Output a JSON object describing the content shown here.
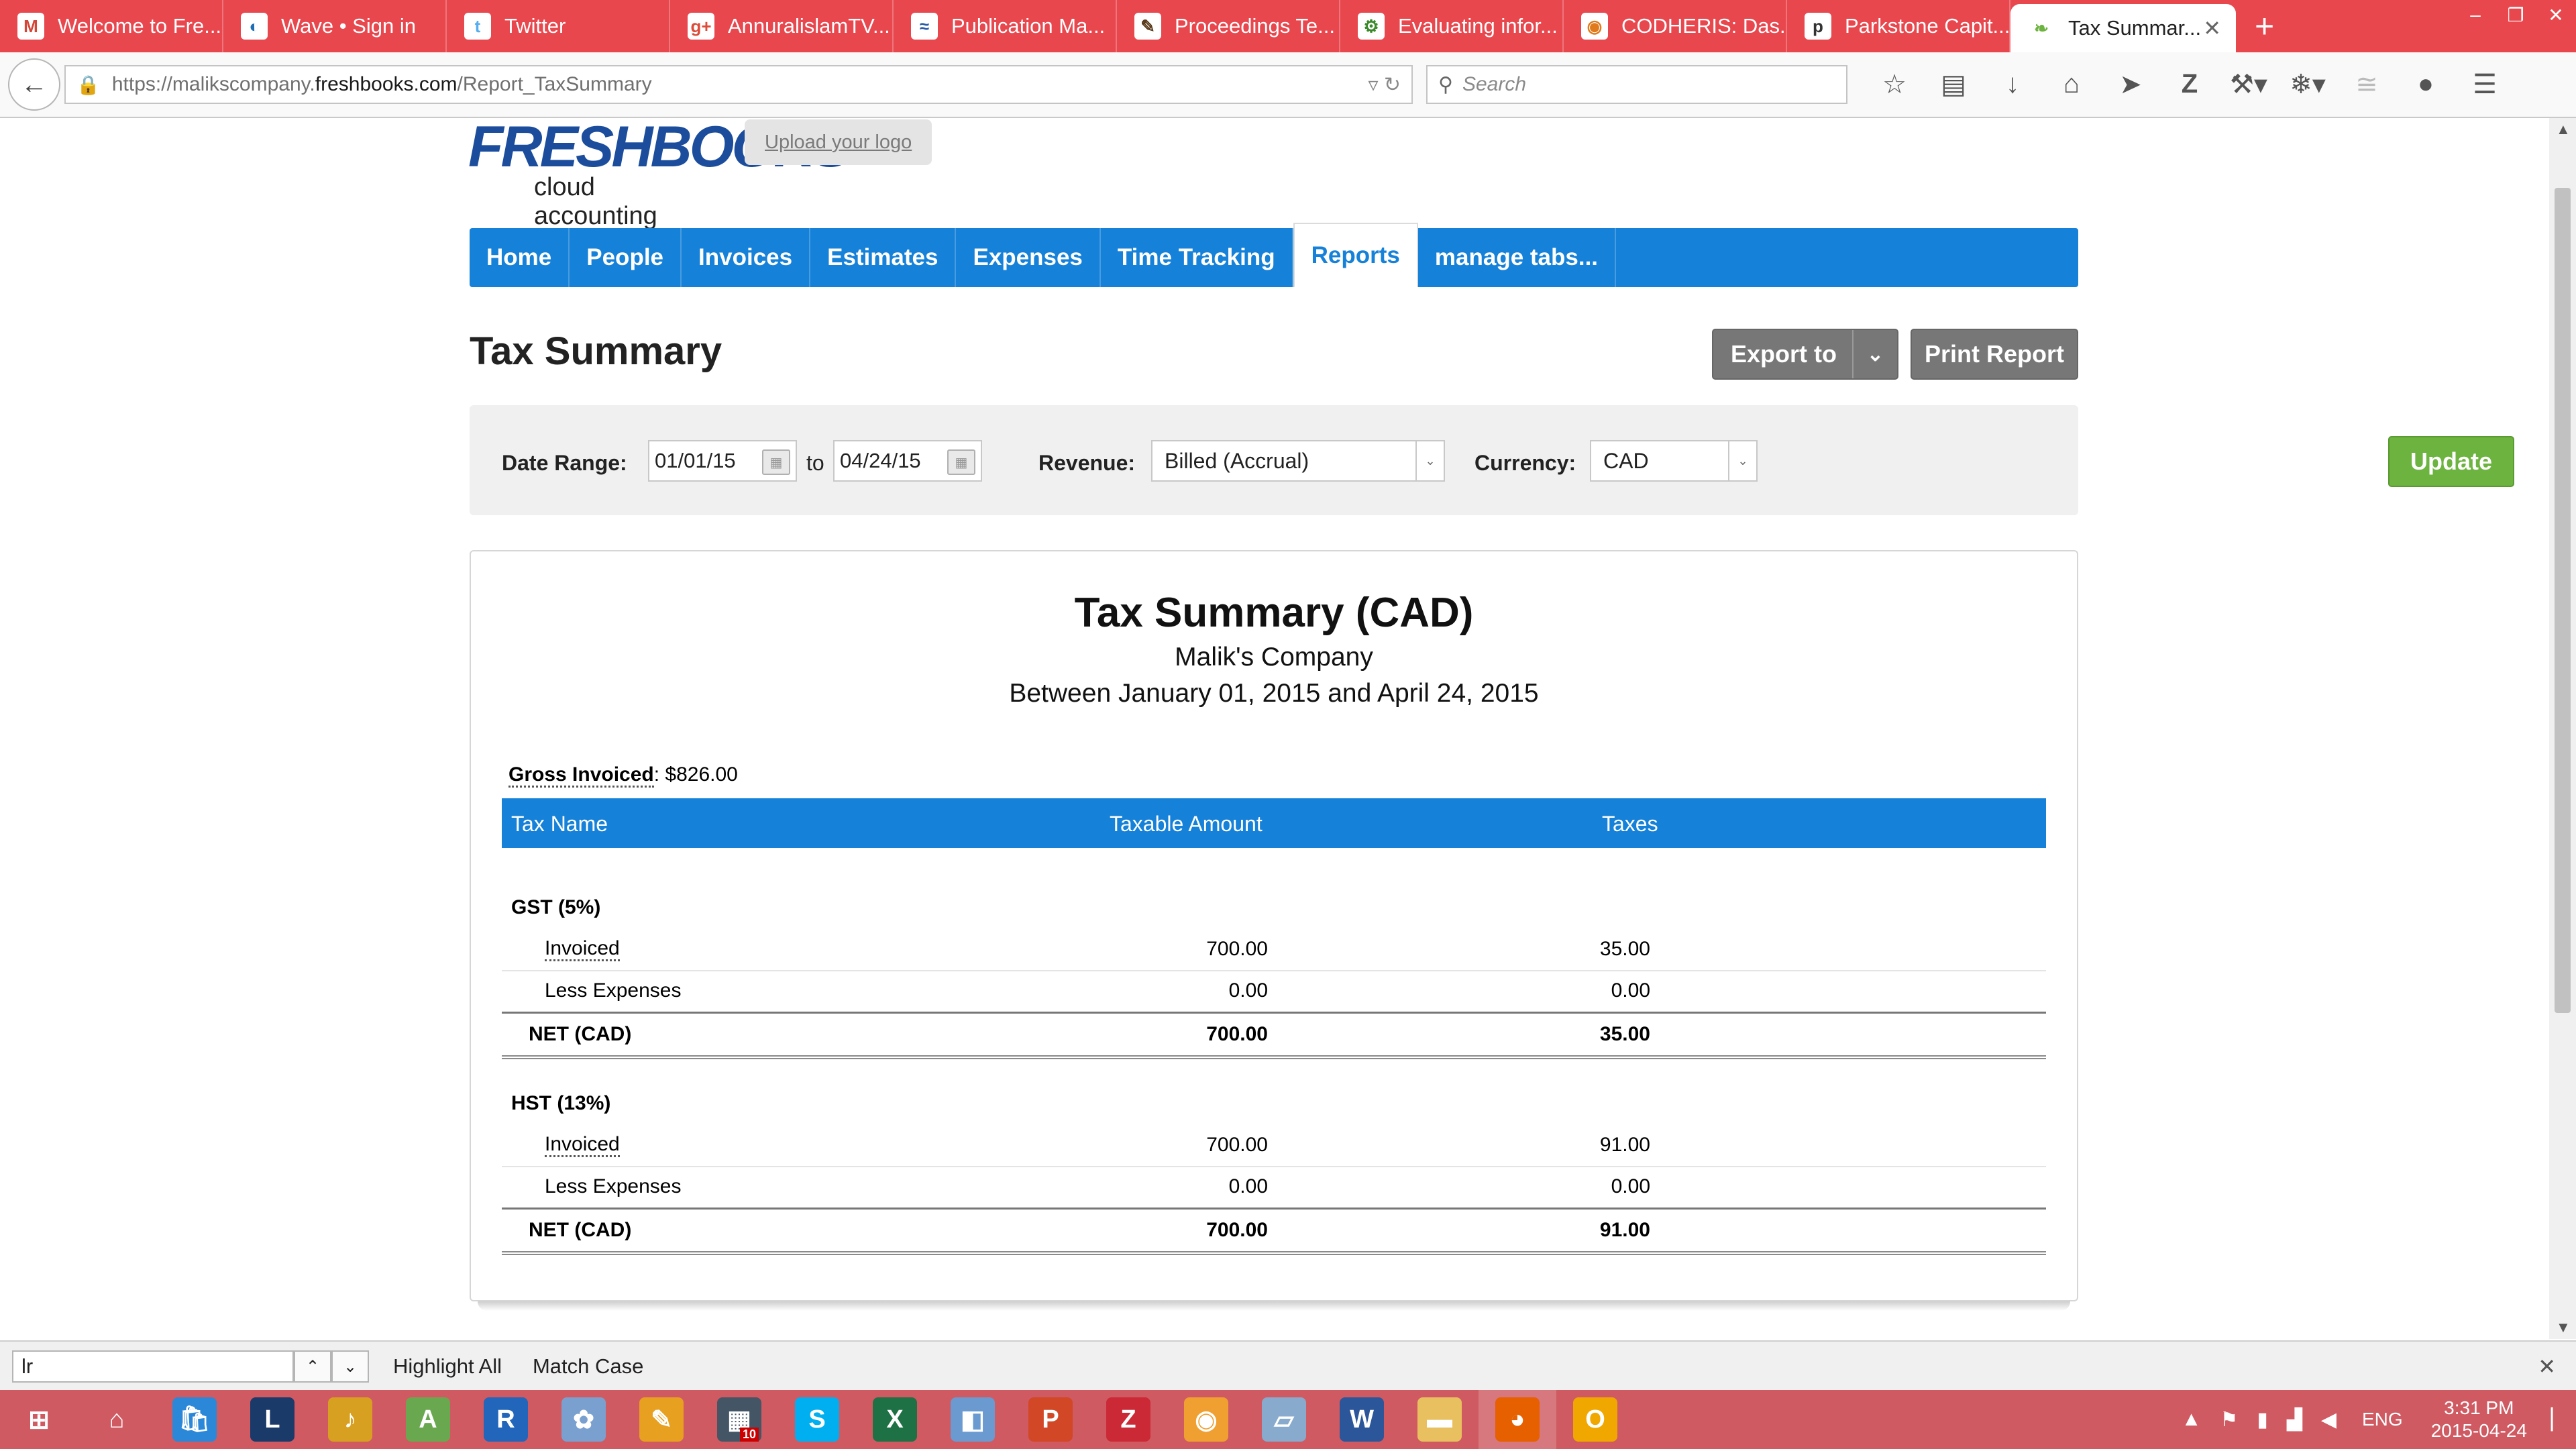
{
  "browser": {
    "tabs": [
      {
        "label": "Welcome to Fre...",
        "icon": "gmail-icon",
        "color": "#d44638",
        "glyph": "M"
      },
      {
        "label": "Wave • Sign in",
        "icon": "wave-icon",
        "color": "#1c6fb5",
        "glyph": "◐"
      },
      {
        "label": "Twitter",
        "icon": "twitter-icon",
        "color": "#55acee",
        "glyph": "t"
      },
      {
        "label": "AnnuralislamTV...",
        "icon": "google-plus-icon",
        "color": "#dd4b39",
        "glyph": "g+"
      },
      {
        "label": "Publication Ma...",
        "icon": "publication-icon",
        "color": "#2a5ca8",
        "glyph": "≈"
      },
      {
        "label": "Proceedings Te...",
        "icon": "proceedings-icon",
        "color": "#5a3a1a",
        "glyph": "✎"
      },
      {
        "label": "Evaluating infor...",
        "icon": "evaluating-icon",
        "color": "#3a8a2a",
        "glyph": "⚙"
      },
      {
        "label": "CODHERIS: Das...",
        "icon": "codheris-icon",
        "color": "#e07a1a",
        "glyph": "◉"
      },
      {
        "label": "Parkstone Capit...",
        "icon": "parkstone-icon",
        "color": "#333333",
        "glyph": "p"
      }
    ],
    "active_tab": "Tax Summar...",
    "url_prefix": "https://malikscompany.",
    "url_domain": "freshbooks.com",
    "url_path": "/Report_TaxSummary",
    "search_placeholder": "Search"
  },
  "app": {
    "logo_text": "FRESHBOOKS",
    "logo_sub": "cloud accounting",
    "upload_logo": "Upload your logo",
    "nav": [
      "Home",
      "People",
      "Invoices",
      "Estimates",
      "Expenses",
      "Time Tracking",
      "Reports",
      "manage tabs..."
    ],
    "active_nav": "Reports",
    "page_title": "Tax Summary",
    "export_label": "Export to",
    "print_label": "Print Report"
  },
  "filters": {
    "date_range_label": "Date Range:",
    "from": "01/01/15",
    "to_label": "to",
    "to": "04/24/15",
    "revenue_label": "Revenue:",
    "revenue_value": "Billed (Accrual)",
    "currency_label": "Currency:",
    "currency_value": "CAD",
    "update_label": "Update"
  },
  "report": {
    "title": "Tax Summary (CAD)",
    "company": "Malik's Company",
    "range": "Between January 01, 2015 and April 24, 2015",
    "gross_label": "Gross Invoiced",
    "gross_value": ": $826.00",
    "columns": [
      "Tax Name",
      "Taxable Amount",
      "Taxes"
    ],
    "groups": [
      {
        "name": "GST (5%)",
        "rows": [
          {
            "name": "Invoiced",
            "amount": "700.00",
            "tax": "35.00"
          },
          {
            "name": "Less Expenses",
            "amount": "0.00",
            "tax": "0.00"
          }
        ],
        "net": {
          "name": "NET (CAD)",
          "amount": "700.00",
          "tax": "35.00"
        }
      },
      {
        "name": "HST (13%)",
        "rows": [
          {
            "name": "Invoiced",
            "amount": "700.00",
            "tax": "91.00"
          },
          {
            "name": "Less Expenses",
            "amount": "0.00",
            "tax": "0.00"
          }
        ],
        "net": {
          "name": "NET (CAD)",
          "amount": "700.00",
          "tax": "91.00"
        }
      }
    ]
  },
  "findbar": {
    "query": "lr",
    "highlight_all": "Highlight All",
    "match_case": "Match Case"
  },
  "taskbar": {
    "apps": [
      {
        "name": "windows-start-icon",
        "color": "#cf5a62",
        "glyph": "⊞"
      },
      {
        "name": "home-icon",
        "color": "#cf5a62",
        "glyph": "⌂"
      },
      {
        "name": "store-icon",
        "color": "#2b88d8",
        "glyph": "🛍"
      },
      {
        "name": "lenovo-icon",
        "color": "#1a3a6a",
        "glyph": "L"
      },
      {
        "name": "audio-app-icon",
        "color": "#d8a020",
        "glyph": "♪"
      },
      {
        "name": "android-studio-icon",
        "color": "#6aa84f",
        "glyph": "A"
      },
      {
        "name": "r-icon",
        "color": "#2266bb",
        "glyph": "R"
      },
      {
        "name": "paint-icon",
        "color": "#7aa0d0",
        "glyph": "✿"
      },
      {
        "name": "sticky-notes-icon",
        "color": "#e8a020",
        "glyph": "✎"
      },
      {
        "name": "calculator-icon",
        "color": "#445566",
        "glyph": "▦"
      },
      {
        "name": "skype-icon",
        "color": "#00aff0",
        "glyph": "S"
      },
      {
        "name": "excel-icon",
        "color": "#1e7145",
        "glyph": "X"
      },
      {
        "name": "virtualbox-icon",
        "color": "#6a9ad0",
        "glyph": "◧"
      },
      {
        "name": "powerpoint-icon",
        "color": "#d24726",
        "glyph": "P"
      },
      {
        "name": "zotero-icon",
        "color": "#cc2936",
        "glyph": "Z"
      },
      {
        "name": "chrome-app-icon",
        "color": "#f0a030",
        "glyph": "◉"
      },
      {
        "name": "tablet-app-icon",
        "color": "#88aacc",
        "glyph": "▱"
      },
      {
        "name": "word-icon",
        "color": "#2b579a",
        "glyph": "W"
      },
      {
        "name": "file-explorer-icon",
        "color": "#e8c060",
        "glyph": "▬"
      },
      {
        "name": "firefox-icon",
        "color": "#e66000",
        "glyph": "◕"
      },
      {
        "name": "outlook-icon",
        "color": "#f0a800",
        "glyph": "O"
      }
    ],
    "badge": "10",
    "lang": "ENG",
    "time": "3:31 PM",
    "date": "2015-04-24"
  }
}
